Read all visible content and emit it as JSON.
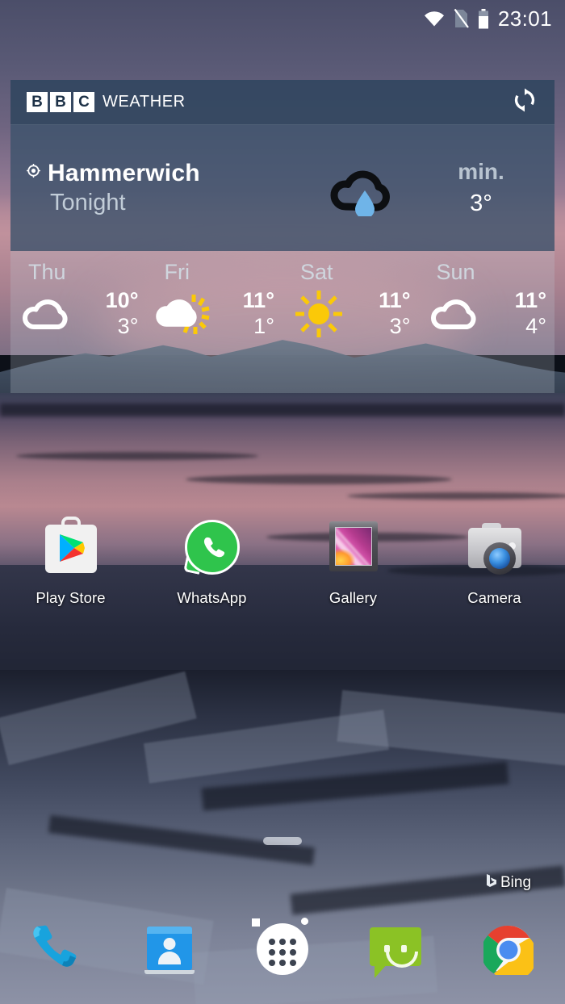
{
  "status_bar": {
    "time": "23:01",
    "icons": [
      "wifi-icon",
      "no-sim-icon",
      "battery-icon"
    ]
  },
  "weather_widget": {
    "brand": {
      "b1": "B",
      "b2": "B",
      "b3": "C",
      "word": "WEATHER"
    },
    "refresh_icon": "refresh-icon",
    "location_icon": "location-pin-icon",
    "location": "Hammerwich",
    "period": "Tonight",
    "current_condition_icon": "cloud-rain-icon",
    "min_label": "min.",
    "min_temp": "3°",
    "forecast": [
      {
        "day": "Thu",
        "icon": "cloud-icon",
        "high": "10°",
        "low": "3°"
      },
      {
        "day": "Fri",
        "icon": "cloud-sun-icon",
        "high": "11°",
        "low": "1°"
      },
      {
        "day": "Sat",
        "icon": "sun-icon",
        "high": "11°",
        "low": "3°"
      },
      {
        "day": "Sun",
        "icon": "cloud-icon",
        "high": "11°",
        "low": "4°"
      }
    ]
  },
  "app_grid": [
    {
      "label": "Play Store",
      "icon": "play-store-icon"
    },
    {
      "label": "WhatsApp",
      "icon": "whatsapp-icon"
    },
    {
      "label": "Gallery",
      "icon": "gallery-icon"
    },
    {
      "label": "Camera",
      "icon": "camera-icon"
    }
  ],
  "dock": [
    {
      "name": "phone",
      "icon": "phone-icon"
    },
    {
      "name": "contacts",
      "icon": "contacts-icon"
    },
    {
      "name": "app-drawer",
      "icon": "app-drawer-icon"
    },
    {
      "name": "messaging",
      "icon": "messaging-icon"
    },
    {
      "name": "browser",
      "icon": "chrome-icon",
      "badge_label": "Bing",
      "badge_icon": "bing-logo-icon"
    }
  ],
  "colors": {
    "widget_header_bg": "#30465f",
    "widget_main_bg": "#3c526b",
    "widget_forecast_bg": "#bec6d2",
    "sun_yellow": "#fbc908",
    "rain_blue": "#6fb4e8",
    "whatsapp_green": "#2fc44c",
    "messaging_green": "#8bc225"
  }
}
